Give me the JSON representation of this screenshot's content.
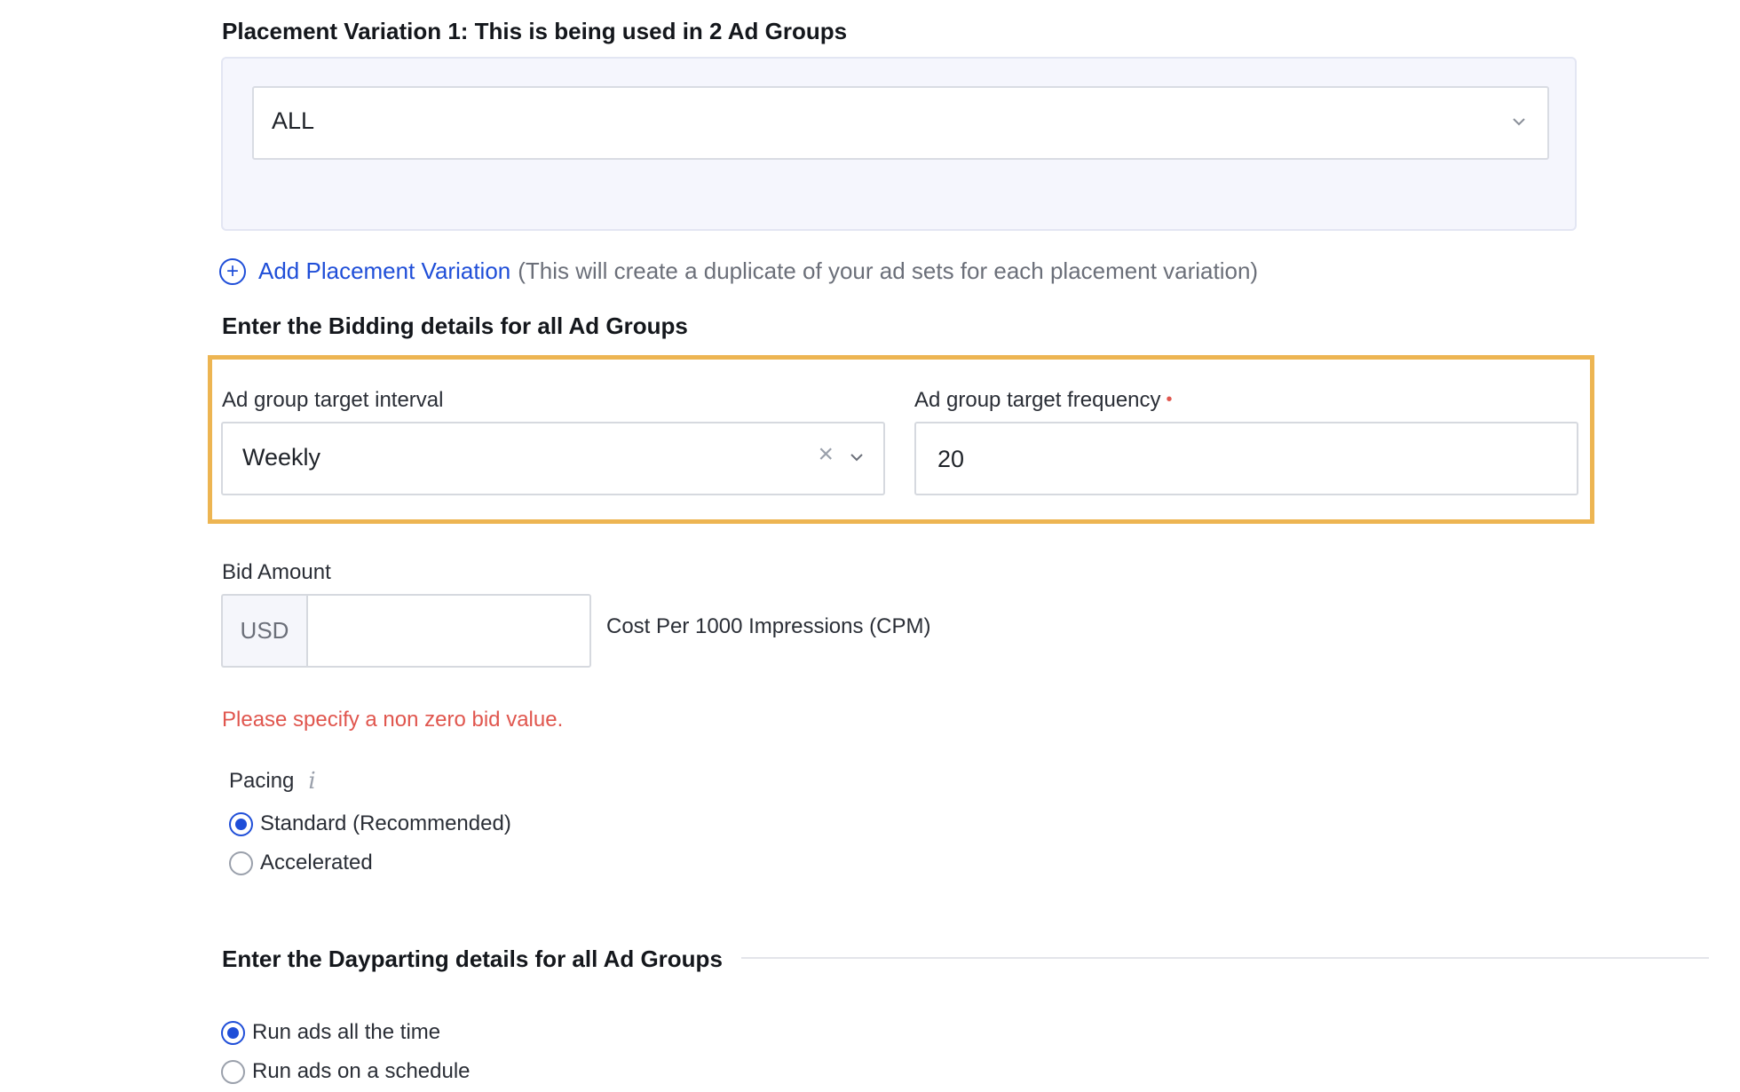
{
  "placement": {
    "title": "Placement Variation 1: This is being used in 2 Ad Groups",
    "selected": "ALL",
    "add_link": "Add Placement Variation",
    "add_note": "(This will create a duplicate of your ad sets for each placement variation)"
  },
  "bidding": {
    "title": "Enter the Bidding details for all Ad Groups",
    "interval_label": "Ad group target interval",
    "interval_value": "Weekly",
    "frequency_label": "Ad group target frequency",
    "frequency_required_mark": "•",
    "frequency_value": "20",
    "highlight_color": "#edb552"
  },
  "bid_amount": {
    "label": "Bid Amount",
    "currency": "USD",
    "value": "",
    "unit_label": "Cost Per 1000 Impressions (CPM)",
    "error": "Please specify a non zero bid value."
  },
  "pacing": {
    "label": "Pacing",
    "info_icon": "i",
    "options": [
      {
        "label": "Standard (Recommended)",
        "selected": true
      },
      {
        "label": "Accelerated",
        "selected": false
      }
    ]
  },
  "dayparting": {
    "title": "Enter the Dayparting details for all Ad Groups",
    "options": [
      {
        "label": "Run ads all the time",
        "selected": true
      },
      {
        "label": "Run ads on a schedule",
        "selected": false
      }
    ]
  },
  "colors": {
    "accent": "#1f4ed8",
    "error": "#e0564e"
  }
}
